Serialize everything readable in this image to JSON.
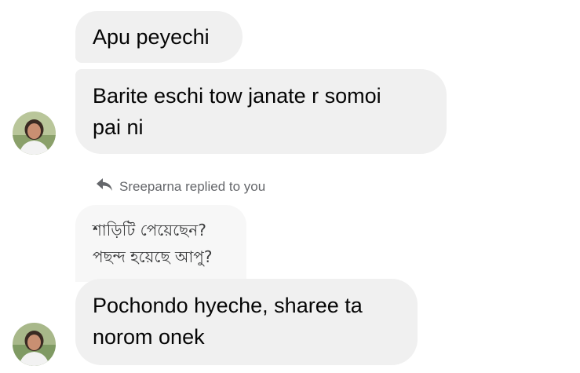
{
  "messages": [
    {
      "text": "Apu peyechi"
    },
    {
      "text": "Barite eschi tow janate r somoi\npai ni"
    },
    {
      "text": "Pochondo hyeche, sharee ta\nnorom onek"
    }
  ],
  "reply": {
    "label": "Sreeparna replied to you",
    "quoted_line1": "শাড়িটি পেয়েছেন?",
    "quoted_line2": "পছন্দ হয়েছে আপু?"
  },
  "icons": {
    "reply": "reply-arrow-icon",
    "avatar": "contact-avatar"
  },
  "colors": {
    "bubble": "#f0f0f0",
    "quoted_bubble": "#f7f7f7",
    "meta_text": "#65676b"
  }
}
